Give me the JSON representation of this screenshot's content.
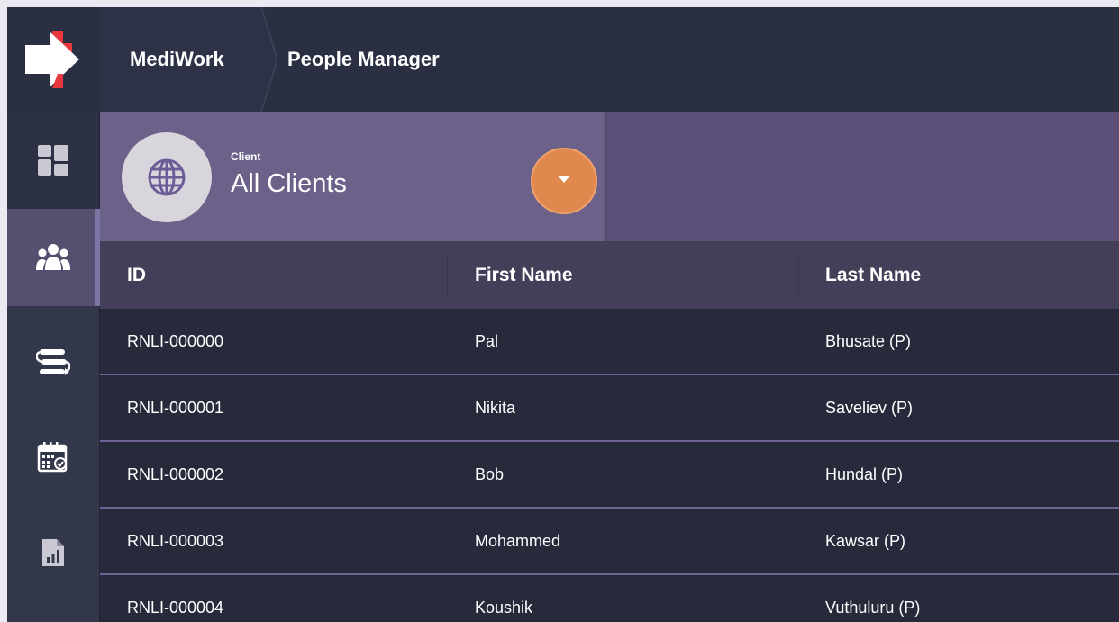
{
  "header": {
    "app_name": "MediWork",
    "page_title": "People Manager"
  },
  "sidebar": {
    "items": [
      {
        "icon": "dashboard-icon",
        "active": false
      },
      {
        "icon": "people-icon",
        "active": true
      },
      {
        "icon": "workflow-icon",
        "active": false
      },
      {
        "icon": "calendar-icon",
        "active": false
      },
      {
        "icon": "report-icon",
        "active": false
      }
    ]
  },
  "filter": {
    "label": "Client",
    "value": "All Clients",
    "icon": "globe-icon"
  },
  "table": {
    "columns": [
      "ID",
      "First Name",
      "Last Name"
    ],
    "rows": [
      {
        "id": "RNLI-000000",
        "first": "Pal",
        "last": "Bhusate (P)"
      },
      {
        "id": "RNLI-000001",
        "first": "Nikita",
        "last": "Saveliev (P)"
      },
      {
        "id": "RNLI-000002",
        "first": "Bob",
        "last": "Hundal (P)"
      },
      {
        "id": "RNLI-000003",
        "first": "Mohammed",
        "last": "Kawsar (P)"
      },
      {
        "id": "RNLI-000004",
        "first": "Koushik",
        "last": "Vuthuluru (P)"
      }
    ]
  },
  "colors": {
    "accent": "#e0894e",
    "header_bg": "#2b2f42",
    "filter_bg": "#6b6189",
    "row_divider": "#6e6396"
  }
}
